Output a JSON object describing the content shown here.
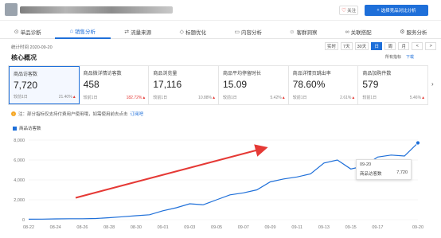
{
  "header": {
    "follow_label": "关注",
    "follow_icon": "heart-icon",
    "primary_label": "选择竞品对比分析",
    "primary_icon": "plus-icon",
    "accent": "#1e6fd9"
  },
  "tabs": [
    {
      "label": "单品诊断",
      "icon": "diagnosis-icon"
    },
    {
      "label": "销售分析",
      "icon": "sales-icon",
      "active": true
    },
    {
      "label": "流量来源",
      "icon": "traffic-icon"
    },
    {
      "label": "标题优化",
      "icon": "title-icon"
    },
    {
      "label": "内容分析",
      "icon": "content-icon"
    },
    {
      "label": "客群洞察",
      "icon": "audience-icon"
    },
    {
      "label": "关联搭配",
      "icon": "link-icon"
    },
    {
      "label": "服务分析",
      "icon": "service-icon"
    }
  ],
  "time_row": {
    "stat_time": "统计时间 2020-09-20",
    "ranges": [
      {
        "label": "实时"
      },
      {
        "label": "7天"
      },
      {
        "label": "30天"
      },
      {
        "label": "日",
        "active": true
      },
      {
        "label": "周"
      },
      {
        "label": "月"
      },
      {
        "label": "<"
      },
      {
        "label": ">"
      }
    ]
  },
  "core": {
    "title": "核心概况",
    "all_metrics": "所有指标",
    "download": "下载",
    "cards": [
      {
        "label": "商品访客数",
        "value": "7,720",
        "cmp": "较前1日",
        "pct": "21.40%",
        "pct_red": false,
        "selected": true
      },
      {
        "label": "商品微详情访客数",
        "value": "458",
        "cmp": "较前1日",
        "pct": "182.72%",
        "pct_red": true,
        "selected": false
      },
      {
        "label": "商品浏览量",
        "value": "17,116",
        "cmp": "较前1日",
        "pct": "10.88%",
        "pct_red": false,
        "selected": false
      },
      {
        "label": "商品平均停留时长",
        "value": "15.09",
        "cmp": "较前1日",
        "pct": "5.42%",
        "pct_red": false,
        "selected": false
      },
      {
        "label": "商品详情页跳出率",
        "value": "78.60%",
        "cmp": "较前1日",
        "pct": "2.61%",
        "pct_red": false,
        "selected": false
      },
      {
        "label": "商品加购件数",
        "value": "579",
        "cmp": "较前1日",
        "pct": "5.46%",
        "pct_red": false,
        "selected": false
      }
    ]
  },
  "notice": {
    "text": "!",
    "message": "注：部分指标仅支持付费用户使用哦，如需使用前去点击",
    "link": "订阅吧"
  },
  "chart_data": {
    "type": "line",
    "title": "",
    "legend": [
      "商品访客数"
    ],
    "xlabel": "",
    "ylabel": "",
    "ylim": [
      0,
      8000
    ],
    "yticks": [
      "0",
      "2,000",
      "4,000",
      "6,000",
      "8,000"
    ],
    "x": [
      "08-22",
      "08-23",
      "08-24",
      "08-25",
      "08-26",
      "08-27",
      "08-28",
      "08-29",
      "08-30",
      "08-31",
      "09-01",
      "09-02",
      "09-03",
      "09-04",
      "09-05",
      "09-06",
      "09-07",
      "09-08",
      "09-09",
      "09-10",
      "09-11",
      "09-12",
      "09-13",
      "09-14",
      "09-15",
      "09-16",
      "09-17",
      "09-18",
      "09-19",
      "09-20"
    ],
    "xtick_labels": [
      "08-22",
      "08-24",
      "08-26",
      "08-28",
      "08-30",
      "09-01",
      "09-03",
      "09-05",
      "09-07",
      "09-09",
      "09-11",
      "09-13",
      "09-15",
      "09-17",
      "09-20"
    ],
    "series": [
      {
        "name": "商品访客数",
        "color": "#1e6fd9",
        "values": [
          50,
          60,
          80,
          100,
          100,
          120,
          200,
          300,
          400,
          500,
          900,
          1200,
          1600,
          1500,
          2000,
          2500,
          2700,
          3000,
          3800,
          4100,
          4300,
          4600,
          5700,
          6000,
          5100,
          5400,
          6300,
          6500,
          6400,
          7720
        ]
      }
    ],
    "tooltip": {
      "date": "09-20",
      "series": "商品访客数",
      "value": "7,720"
    },
    "annotation": {
      "type": "red-arrow",
      "direction": "up-right"
    }
  }
}
